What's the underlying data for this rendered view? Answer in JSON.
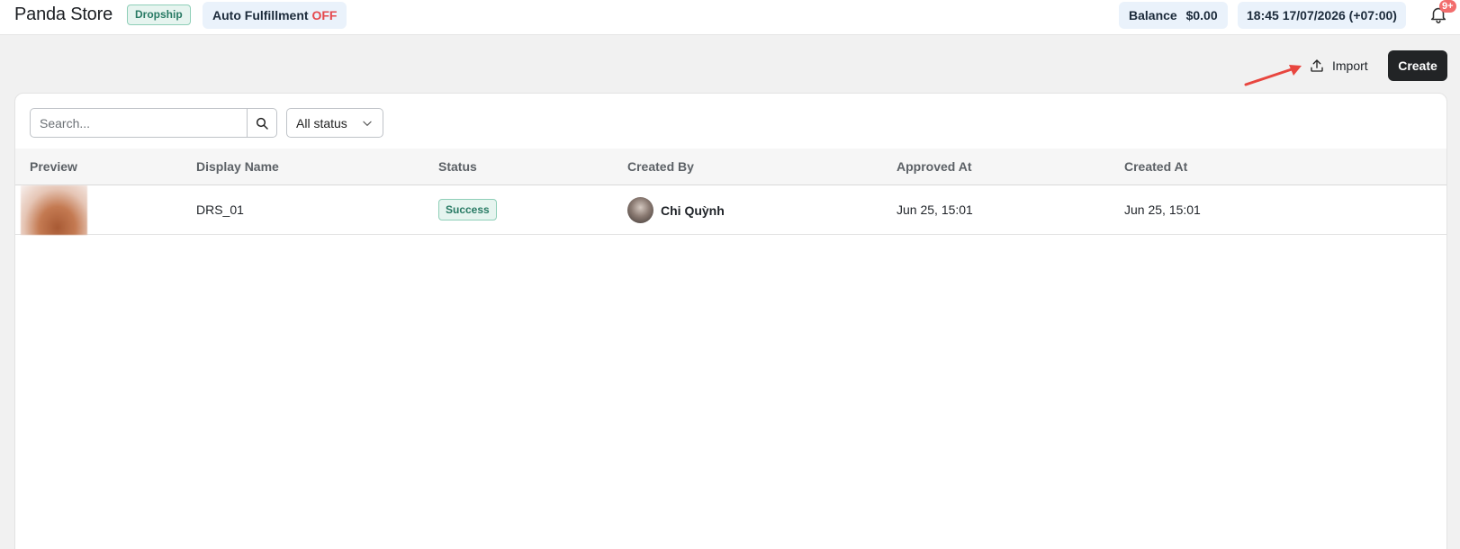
{
  "header": {
    "store_name": "Panda Store",
    "store_badge": "Dropship",
    "auto_fulfillment_label": "Auto Fulfillment",
    "auto_fulfillment_state": "OFF",
    "balance_label": "Balance",
    "balance_amount": "$0.00",
    "datetime": "18:45 17/07/2026 (+07:00)",
    "notification_count": "9+",
    "colors": {
      "badge_green": "#287a64",
      "off_red": "#e5484d",
      "chip_bg": "#eaf2fb"
    }
  },
  "actions": {
    "import_label": "Import",
    "create_label": "Create"
  },
  "filters": {
    "search_placeholder": "Search...",
    "search_value": "",
    "status_selected": "All status"
  },
  "table": {
    "columns": [
      "Preview",
      "Display Name",
      "Status",
      "Created By",
      "Approved At",
      "Created At"
    ],
    "rows": [
      {
        "display_name": "DRS_01",
        "status": "Success",
        "created_by": "Chi Quỳnh",
        "approved_at": "Jun 25, 15:01",
        "created_at": "Jun 25, 15:01"
      }
    ]
  },
  "icons": {
    "search": "search-icon",
    "chevron": "chevron-down-icon",
    "upload": "upload-icon",
    "bell": "bell-icon"
  }
}
